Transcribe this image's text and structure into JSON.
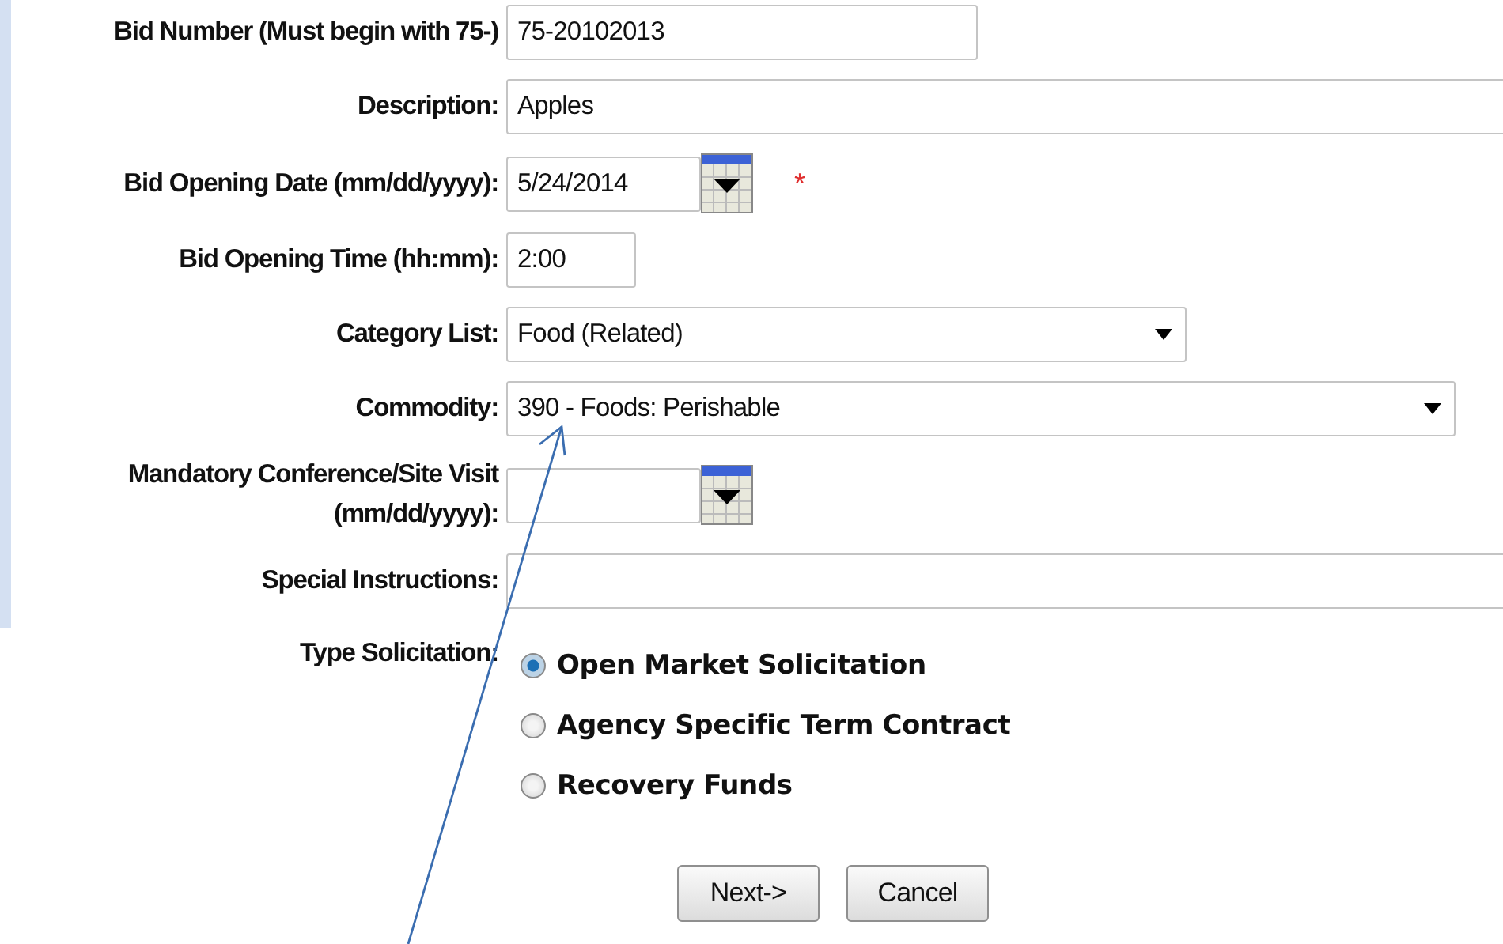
{
  "fields": [
    {
      "label": "Bid Number (Must begin with 75-)",
      "kind": "text",
      "value": "75-20102013"
    },
    {
      "label": "Description:",
      "kind": "wide",
      "value": "Apples"
    },
    {
      "label": "Bid Opening Date (mm/dd/yyyy):",
      "kind": "date",
      "value": "5/24/2014",
      "required_mark": "*"
    },
    {
      "label": "Bid Opening Time (hh:mm):",
      "kind": "time",
      "value": "2:00"
    },
    {
      "label": "Category List:",
      "kind": "select",
      "value": "Food (Related)"
    },
    {
      "label": "Commodity:",
      "kind": "wide-select",
      "value": "390 - Foods: Perishable"
    },
    {
      "label": "Mandatory Conference/Site Visit (mm/dd/yyyy):",
      "kind": "date"
    },
    {
      "label": "Special Instructions:",
      "kind": "wide"
    }
  ],
  "solicitation": {
    "label": "Type Solicitation:",
    "options": [
      {
        "label": "Open Market Solicitation",
        "selected": true
      },
      {
        "label": "Agency Specific Term Contract",
        "selected": false
      },
      {
        "label": "Recovery Funds",
        "selected": false
      }
    ]
  },
  "buttons": [
    "Next->",
    "Cancel"
  ]
}
